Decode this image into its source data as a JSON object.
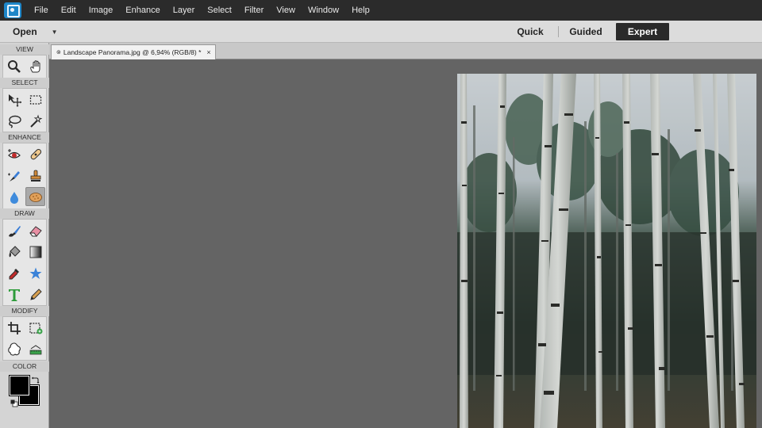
{
  "menubar": {
    "app_icon": "elements-logo-icon",
    "items": [
      "File",
      "Edit",
      "Image",
      "Enhance",
      "Layer",
      "Select",
      "Filter",
      "View",
      "Window",
      "Help"
    ]
  },
  "modebar": {
    "open_label": "Open",
    "modes": {
      "quick": "Quick",
      "guided": "Guided",
      "expert": "Expert"
    },
    "active_mode": "Expert"
  },
  "toolbox": {
    "sections": {
      "view": "VIEW",
      "select": "SELECT",
      "enhance": "ENHANCE",
      "draw": "DRAW",
      "modify": "MODIFY",
      "color": "COLOR"
    },
    "active_tool": "sponge-tool",
    "foreground_color": "#000000",
    "background_color": "#000000"
  },
  "document": {
    "tab_title": "Landscape Panorama.jpg @ 6,94% (RGB/8) *",
    "close_glyph": "×"
  },
  "colors": {
    "menubar_bg": "#2b2b2b",
    "modebar_bg": "#dcdcdc",
    "expert_active_bg": "#2a2a2a",
    "canvas_bg": "#646464"
  }
}
